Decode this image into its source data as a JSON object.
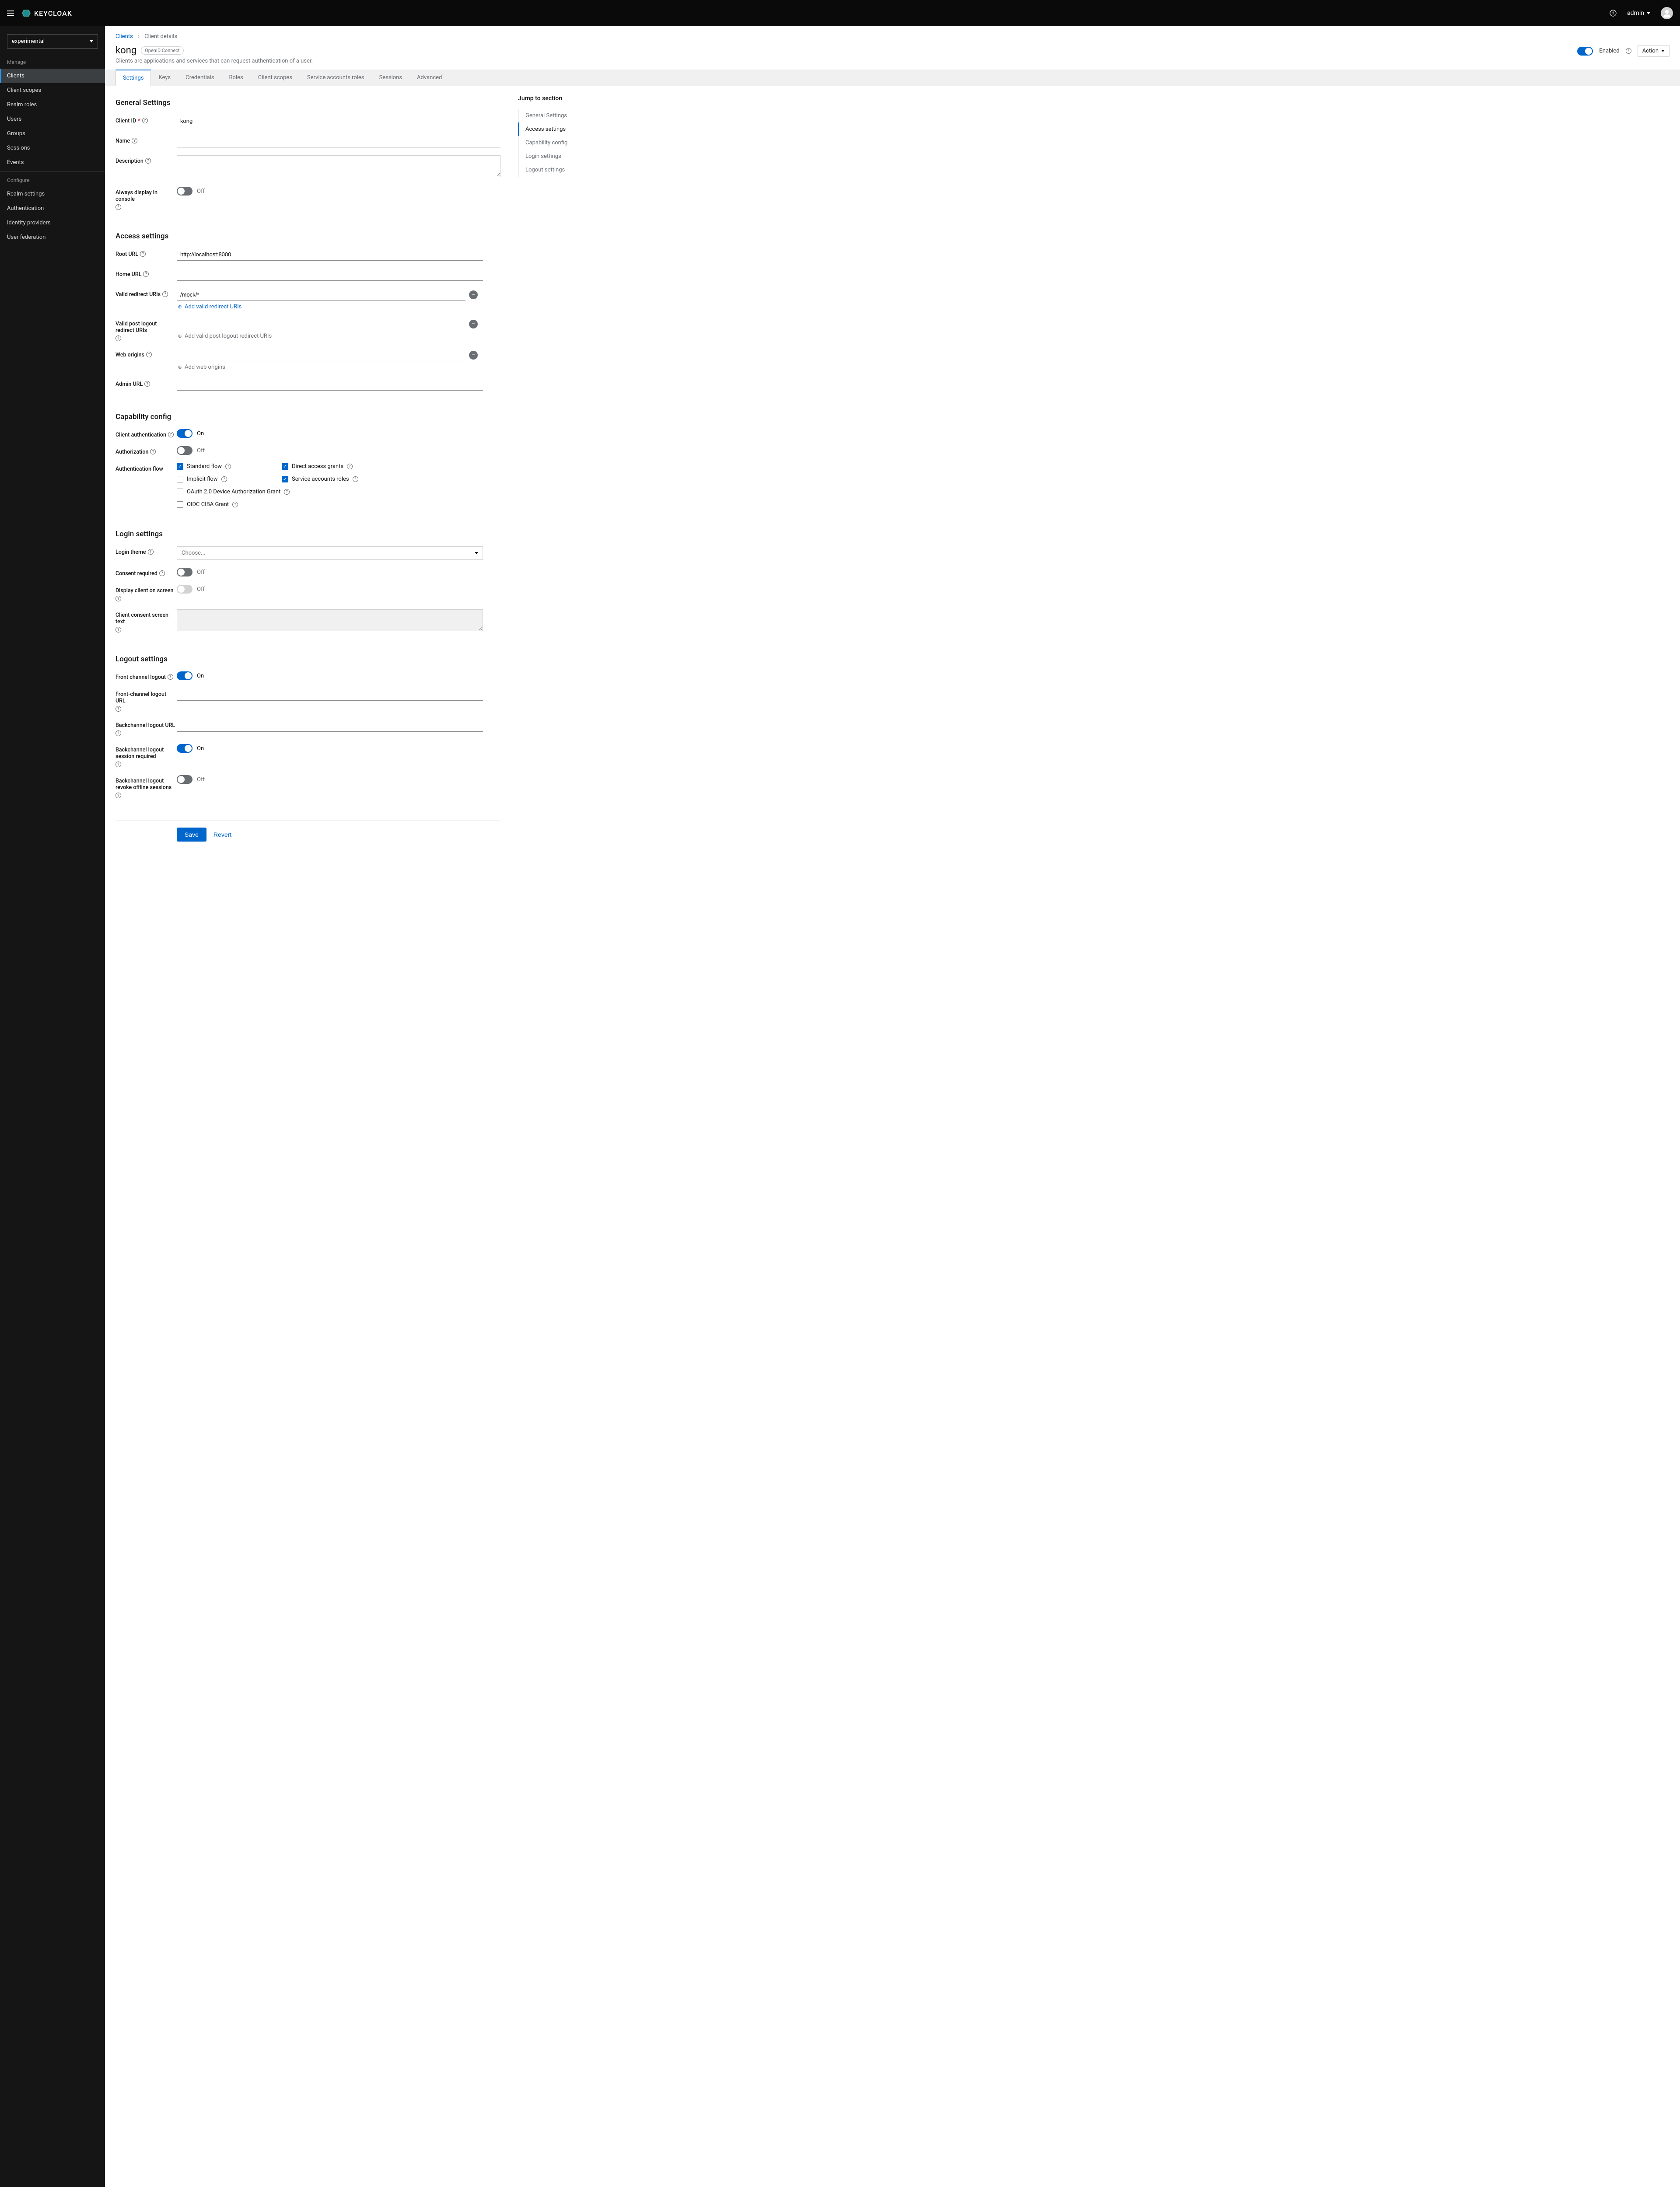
{
  "header": {
    "brand": "KEYCLOAK",
    "user": "admin"
  },
  "sidebar": {
    "realm": "experimental",
    "section_manage": "Manage",
    "section_configure": "Configure",
    "manage_items": [
      "Clients",
      "Client scopes",
      "Realm roles",
      "Users",
      "Groups",
      "Sessions",
      "Events"
    ],
    "configure_items": [
      "Realm settings",
      "Authentication",
      "Identity providers",
      "User federation"
    ]
  },
  "breadcrumb": {
    "clients": "Clients",
    "details": "Client details"
  },
  "page": {
    "title": "kong",
    "badge": "OpenID Connect",
    "description": "Clients are applications and services that can request authentication of a user.",
    "enabled_label": "Enabled",
    "action_label": "Action"
  },
  "tabs": [
    "Settings",
    "Keys",
    "Credentials",
    "Roles",
    "Client scopes",
    "Service accounts roles",
    "Sessions",
    "Advanced"
  ],
  "jump": {
    "title": "Jump to section",
    "items": [
      "General Settings",
      "Access settings",
      "Capability config",
      "Login settings",
      "Logout settings"
    ]
  },
  "sections": {
    "general": {
      "title": "General Settings",
      "client_id_label": "Client ID",
      "client_id_value": "kong",
      "name_label": "Name",
      "name_value": "",
      "description_label": "Description",
      "description_value": "",
      "always_display_label": "Always display in console",
      "always_display_state": "Off"
    },
    "access": {
      "title": "Access settings",
      "root_url_label": "Root URL",
      "root_url_value": "http://localhost:8000",
      "home_url_label": "Home URL",
      "home_url_value": "",
      "redirect_label": "Valid redirect URIs",
      "redirect_value": "/mock/*",
      "add_redirect": "Add valid redirect URIs",
      "post_logout_label": "Valid post logout redirect URIs",
      "add_post_logout": "Add valid post logout redirect URIs",
      "web_origins_label": "Web origins",
      "add_web_origins": "Add web origins",
      "admin_url_label": "Admin URL",
      "admin_url_value": ""
    },
    "capability": {
      "title": "Capability config",
      "client_auth_label": "Client authentication",
      "client_auth_state": "On",
      "authorization_label": "Authorization",
      "authorization_state": "Off",
      "auth_flow_label": "Authentication flow",
      "flows": {
        "standard": "Standard flow",
        "direct": "Direct access grants",
        "implicit": "Implicit flow",
        "service": "Service accounts roles",
        "device": "OAuth 2.0 Device Authorization Grant",
        "ciba": "OIDC CIBA Grant"
      }
    },
    "login": {
      "title": "Login settings",
      "theme_label": "Login theme",
      "theme_placeholder": "Choose...",
      "consent_label": "Consent required",
      "consent_state": "Off",
      "display_client_label": "Display client on screen",
      "display_client_state": "Off",
      "consent_text_label": "Client consent screen text"
    },
    "logout": {
      "title": "Logout settings",
      "front_channel_label": "Front channel logout",
      "front_channel_state": "On",
      "front_url_label": "Front-channel logout URL",
      "back_url_label": "Backchannel logout URL",
      "back_session_label": "Backchannel logout session required",
      "back_session_state": "On",
      "back_revoke_label": "Backchannel logout revoke offline sessions",
      "back_revoke_state": "Off"
    }
  },
  "footer": {
    "save": "Save",
    "revert": "Revert"
  }
}
